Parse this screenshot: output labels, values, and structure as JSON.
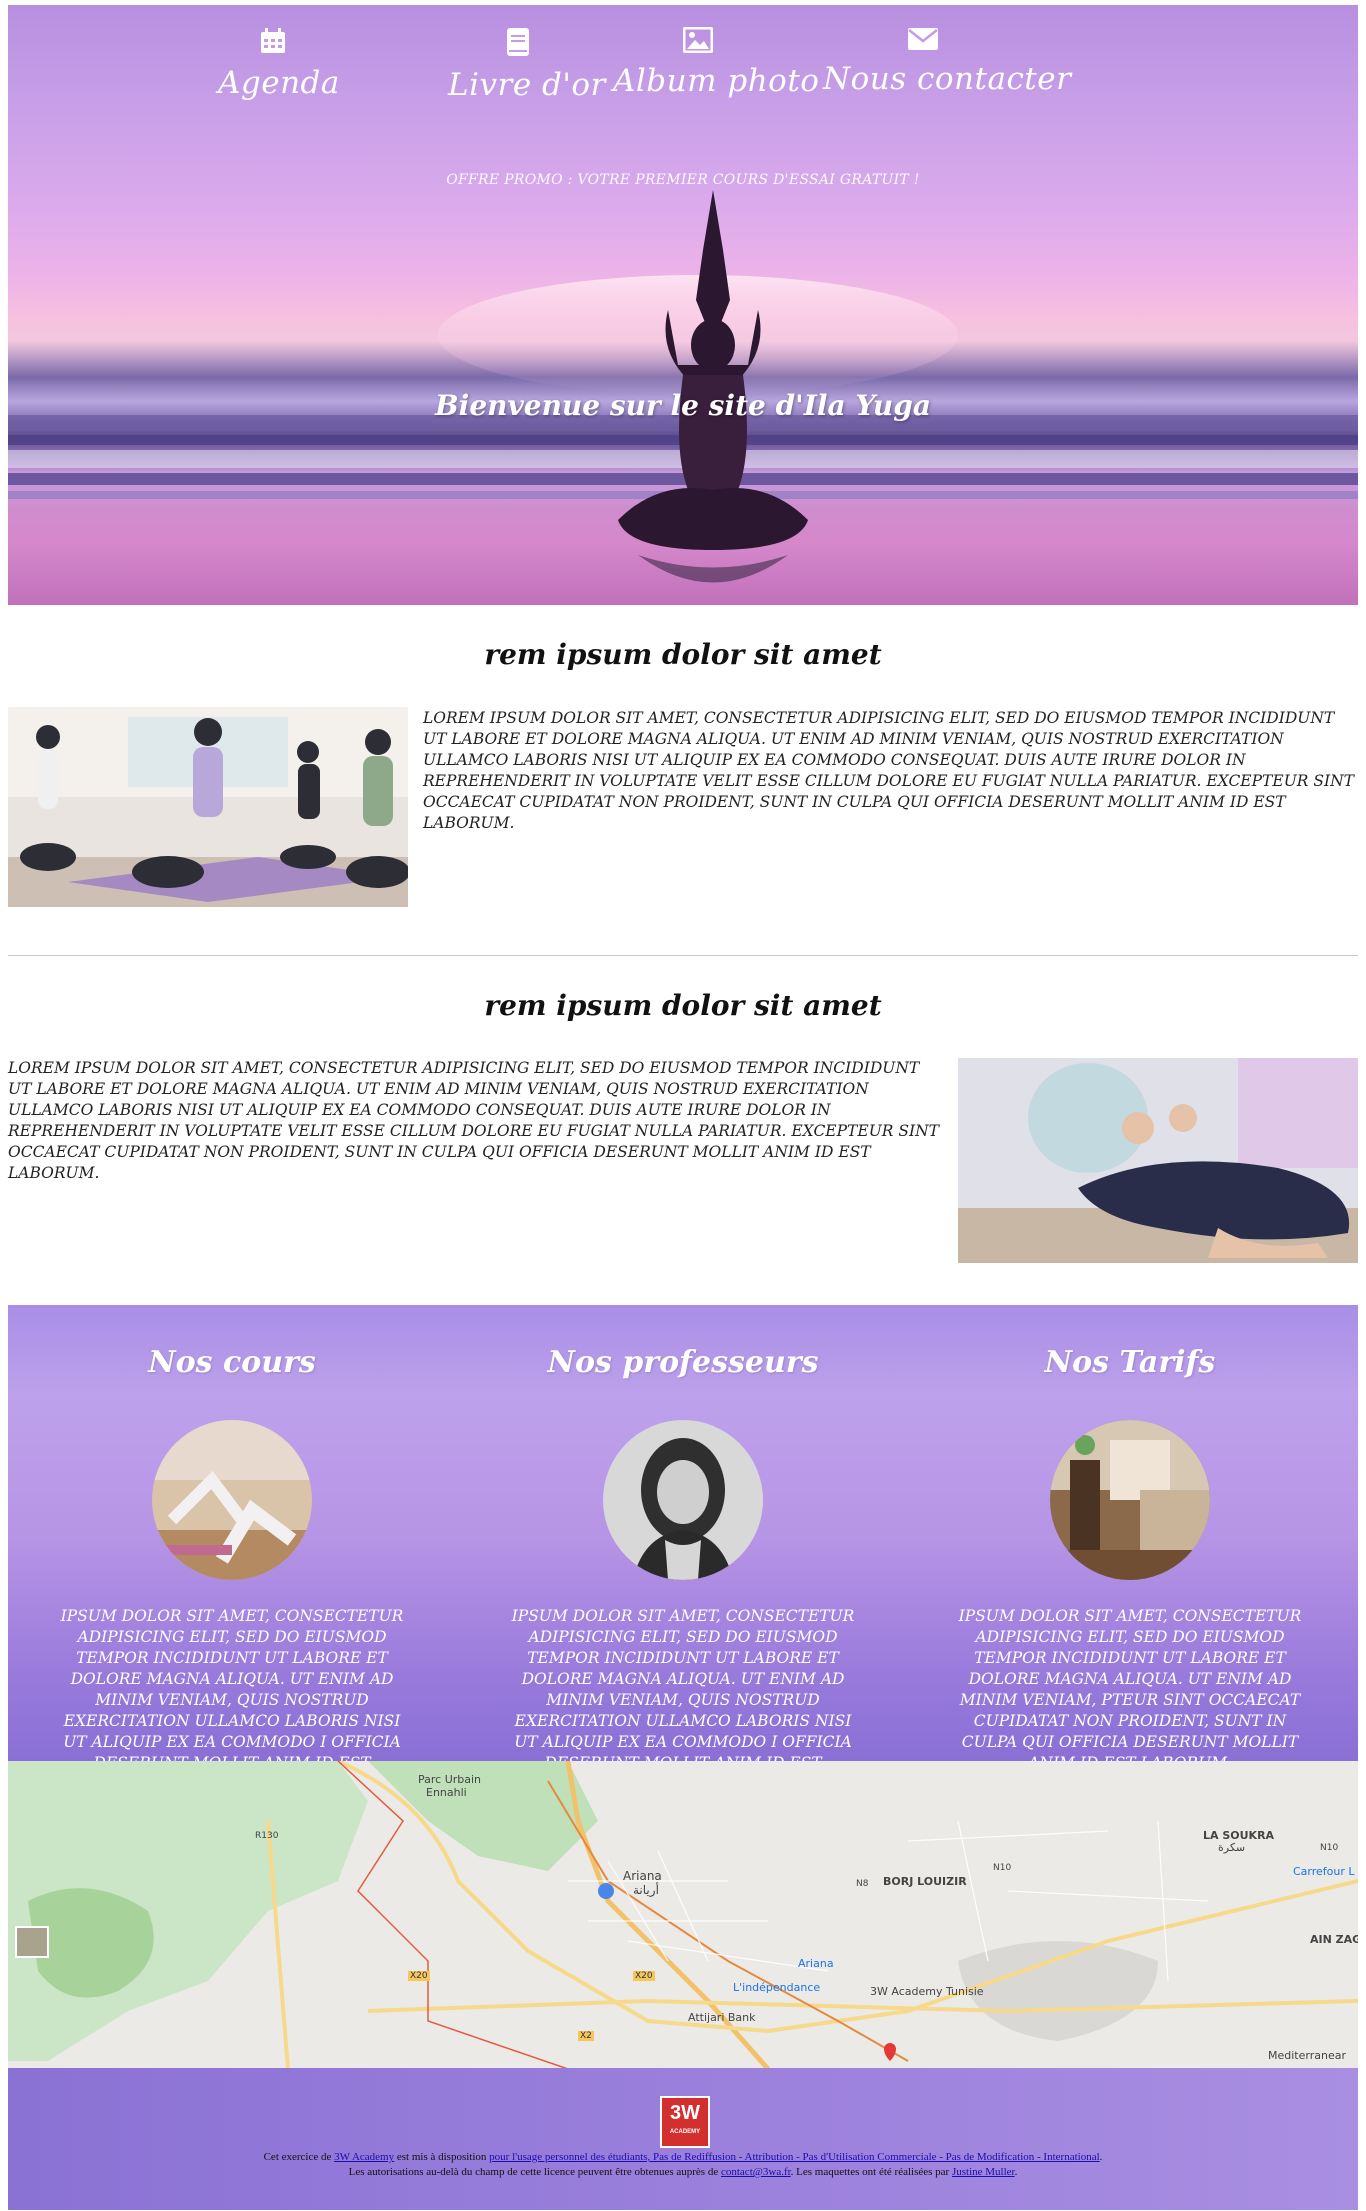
{
  "nav": {
    "items": [
      {
        "label": "Agenda",
        "icon": "calendar-icon"
      },
      {
        "label": "Livre d'or",
        "icon": "book-icon"
      },
      {
        "label": "Album photo",
        "icon": "image-icon"
      },
      {
        "label": "Nous contacter",
        "icon": "envelope-icon"
      }
    ]
  },
  "hero": {
    "promo": "OFFRE PROMO : VOTRE PREMIER COURS D'ESSAI GRATUIT !",
    "welcome": "Bienvenue sur le site d'Ila Yuga"
  },
  "section1": {
    "title": "rem ipsum dolor sit amet",
    "text": "Lorem ipsum dolor sit amet, consectetur adipisicing elit, sed do eiusmod tempor incididunt ut labore et dolore magna aliqua. Ut enim ad minim veniam, quis nostrud exercitation ullamco laboris nisi ut aliquip ex ea commodo consequat. Duis aute irure dolor in reprehenderit in voluptate velit esse cillum dolore eu fugiat nulla pariatur. Excepteur sint occaecat cupidatat non proident, sunt in culpa qui officia deserunt mollit anim id est laborum."
  },
  "section2": {
    "title": "rem ipsum dolor sit amet",
    "text": "Lorem ipsum dolor sit amet, consectetur adipisicing elit, sed do eiusmod tempor incididunt ut labore et dolore magna aliqua. Ut enim ad minim veniam, quis nostrud exercitation ullamco laboris nisi ut aliquip ex ea commodo consequat. Duis aute irure dolor in reprehenderit in voluptate velit esse cillum dolore eu fugiat nulla pariatur. Excepteur sint occaecat cupidatat non proident, sunt in culpa qui officia deserunt mollit anim id est laborum."
  },
  "features": {
    "cours": {
      "title": "Nos cours",
      "text": "ipsum dolor sit amet, consectetur adipisicing elit, sed do eiusmod tempor incididunt ut labore et dolore magna aliqua. Ut enim ad minim veniam, quis nostrud exercitation ullamco laboris nisi ut aliquip ex ea commodo i officia deserunt mollit anim id est laborum."
    },
    "professeurs": {
      "title": "Nos professeurs",
      "text": "ipsum dolor sit amet, consectetur adipisicing elit, sed do eiusmod tempor incididunt ut labore et dolore magna aliqua. Ut enim ad minim veniam, quis nostrud exercitation ullamco laboris nisi ut aliquip ex ea commodo i officia deserunt mollit anim id est laborum."
    },
    "tarifs": {
      "title": "Nos Tarifs",
      "text": "ipsum dolor sit amet, consectetur adipisicing elit, sed do eiusmod tempor incididunt ut labore et dolore magna aliqua. Ut enim ad minim veniam, pteur sint occaecat cupidatat non proident, sunt in culpa qui officia deserunt mollit anim id est laborum."
    }
  },
  "map": {
    "labels": {
      "parc": "Parc Urbain",
      "parc2": "Ennahli",
      "soukra": "LA SOUKRA",
      "soukra_ar": "سكرة",
      "ariana": "Ariana",
      "ariana_ar": "أريانة",
      "borj": "BORJ LOUIZIR",
      "carrefour": "Carrefour L",
      "aizag": "AIN ZAG",
      "ariana_metro": "Ariana",
      "independance": "L'indépendance",
      "academy": "3W Academy Tunisie",
      "attijari": "Attijari Bank",
      "mediterranean": "Mediterranear",
      "r130": "R130",
      "x20": "X20",
      "x20b": "X20",
      "x2": "X2",
      "n10": "N10",
      "n10b": "N10",
      "n8": "N8"
    }
  },
  "footer": {
    "logo_text": "3W",
    "logo_sub": "ACADEMY",
    "line1_pre": "Cet exercice de ",
    "line1_link1": "3W Academy",
    "line1_mid": " est mis à disposition ",
    "line1_link2": "pour l'usage personnel des étudiants, Pas de Rediffusion - Attribution - Pas d'Utilisation Commerciale - Pas de Modification - International",
    "line1_post": ".",
    "line2_pre": "Les autorisations au-delà du champ de cette licence peuvent être obtenues auprès de ",
    "line2_link1": "contact@3wa.fr",
    "line2_mid": ". Les maquettes ont été réalisées par ",
    "line2_link2": "Justine Muller",
    "line2_post": "."
  },
  "colors": {
    "band": "#b795e6",
    "footer": "#9a7fdc",
    "accent": "#d32f2f"
  }
}
